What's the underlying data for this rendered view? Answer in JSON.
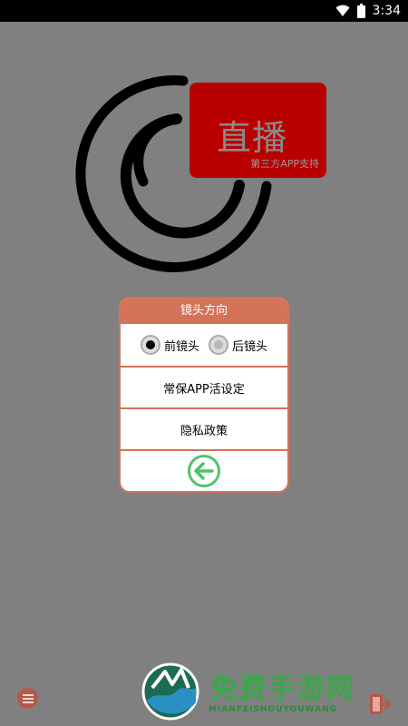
{
  "status_bar": {
    "time": "3:34",
    "wifi_icon": "wifi-icon",
    "battery_icon": "battery-icon"
  },
  "logo": {
    "badge_title": "直播",
    "badge_subtitle": "第三方APP支持",
    "badge_color": "#b80000",
    "ring_color": "#000000"
  },
  "dialog": {
    "title": "镜头方向",
    "camera_options": [
      {
        "label": "前镜头",
        "selected": true
      },
      {
        "label": "后镜头",
        "selected": false
      }
    ],
    "menu_items": [
      {
        "label": "常保APP活设定"
      },
      {
        "label": "隐私政策"
      }
    ],
    "back_icon": "arrow-left-icon",
    "accent_color": "#d4735a",
    "back_color": "#4fc36b"
  },
  "footer": {
    "menu_icon": "menu-icon",
    "exit_icon": "exit-icon",
    "watermark_title": "免费手游网",
    "watermark_sub": "MIANFEISHOUYOUWANG"
  }
}
